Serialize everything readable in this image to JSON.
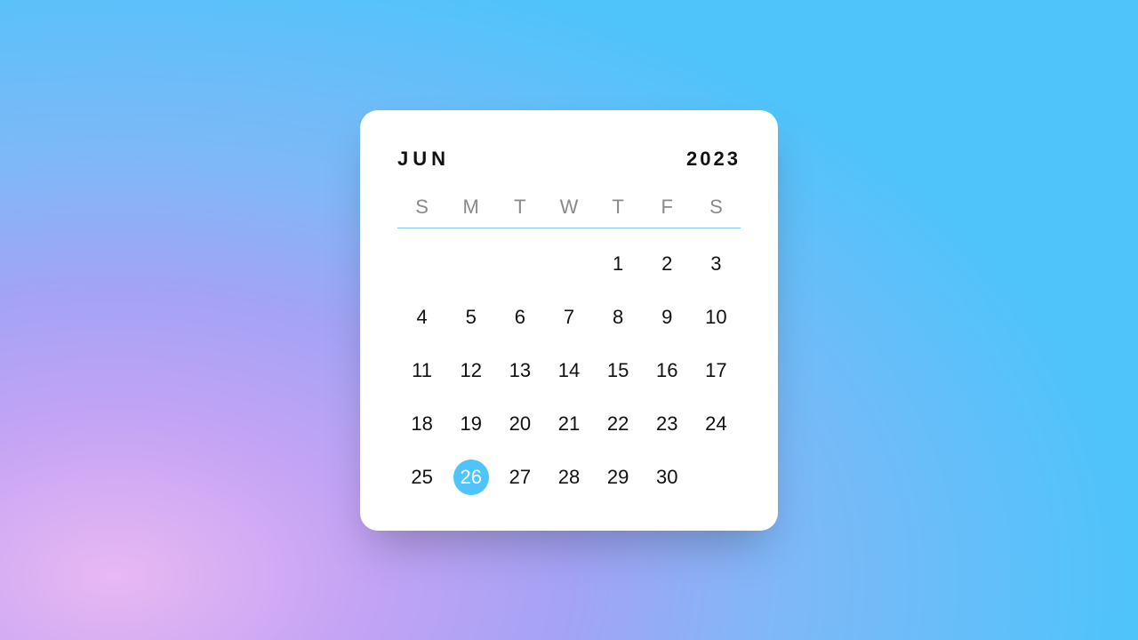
{
  "calendar": {
    "month": "JUN",
    "year": "2023",
    "weekdays": [
      "S",
      "M",
      "T",
      "W",
      "T",
      "F",
      "S"
    ],
    "startOffset": 4,
    "daysInMonth": 30,
    "selectedDay": 26,
    "colors": {
      "accent": "#4ec4fa"
    }
  }
}
